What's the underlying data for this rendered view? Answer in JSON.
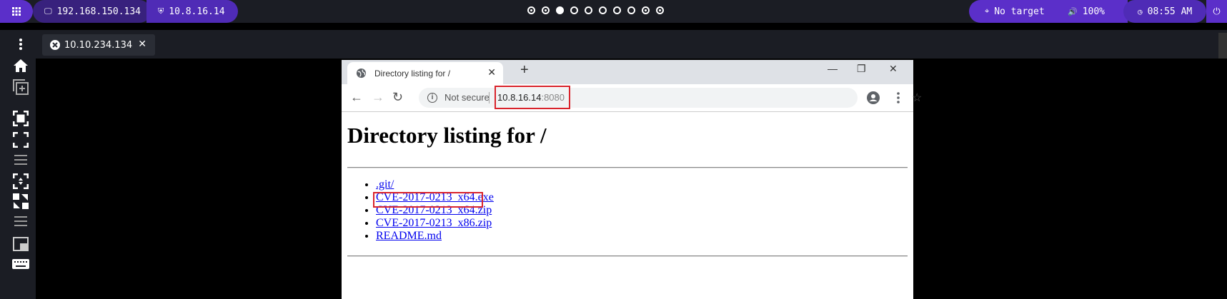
{
  "topbar": {
    "ip1": "192.168.150.134",
    "ip2": "10.8.16.14",
    "target": "No target",
    "volume": "100%",
    "time": "08:55 AM"
  },
  "workspace_dots": [
    "ringed",
    "ringed",
    "filled",
    "empty",
    "empty",
    "empty",
    "empty",
    "empty",
    "ringed",
    "ringed"
  ],
  "remote_tab": {
    "label": "10.10.234.134"
  },
  "browser": {
    "tab_title": "Directory listing for /",
    "not_secure": "Not secure",
    "url_host": "10.8.16.14",
    "url_port": ":8080",
    "heading": "Directory listing for /",
    "files": [
      ".git/",
      "CVE-2017-0213_x64.exe",
      "CVE-2017-0213_x64.zip",
      "CVE-2017-0213_x86.zip",
      "README.md"
    ]
  },
  "colors": {
    "accent": "#5b2fc9",
    "highlight": "#d9232b",
    "link": "#0000ee"
  }
}
